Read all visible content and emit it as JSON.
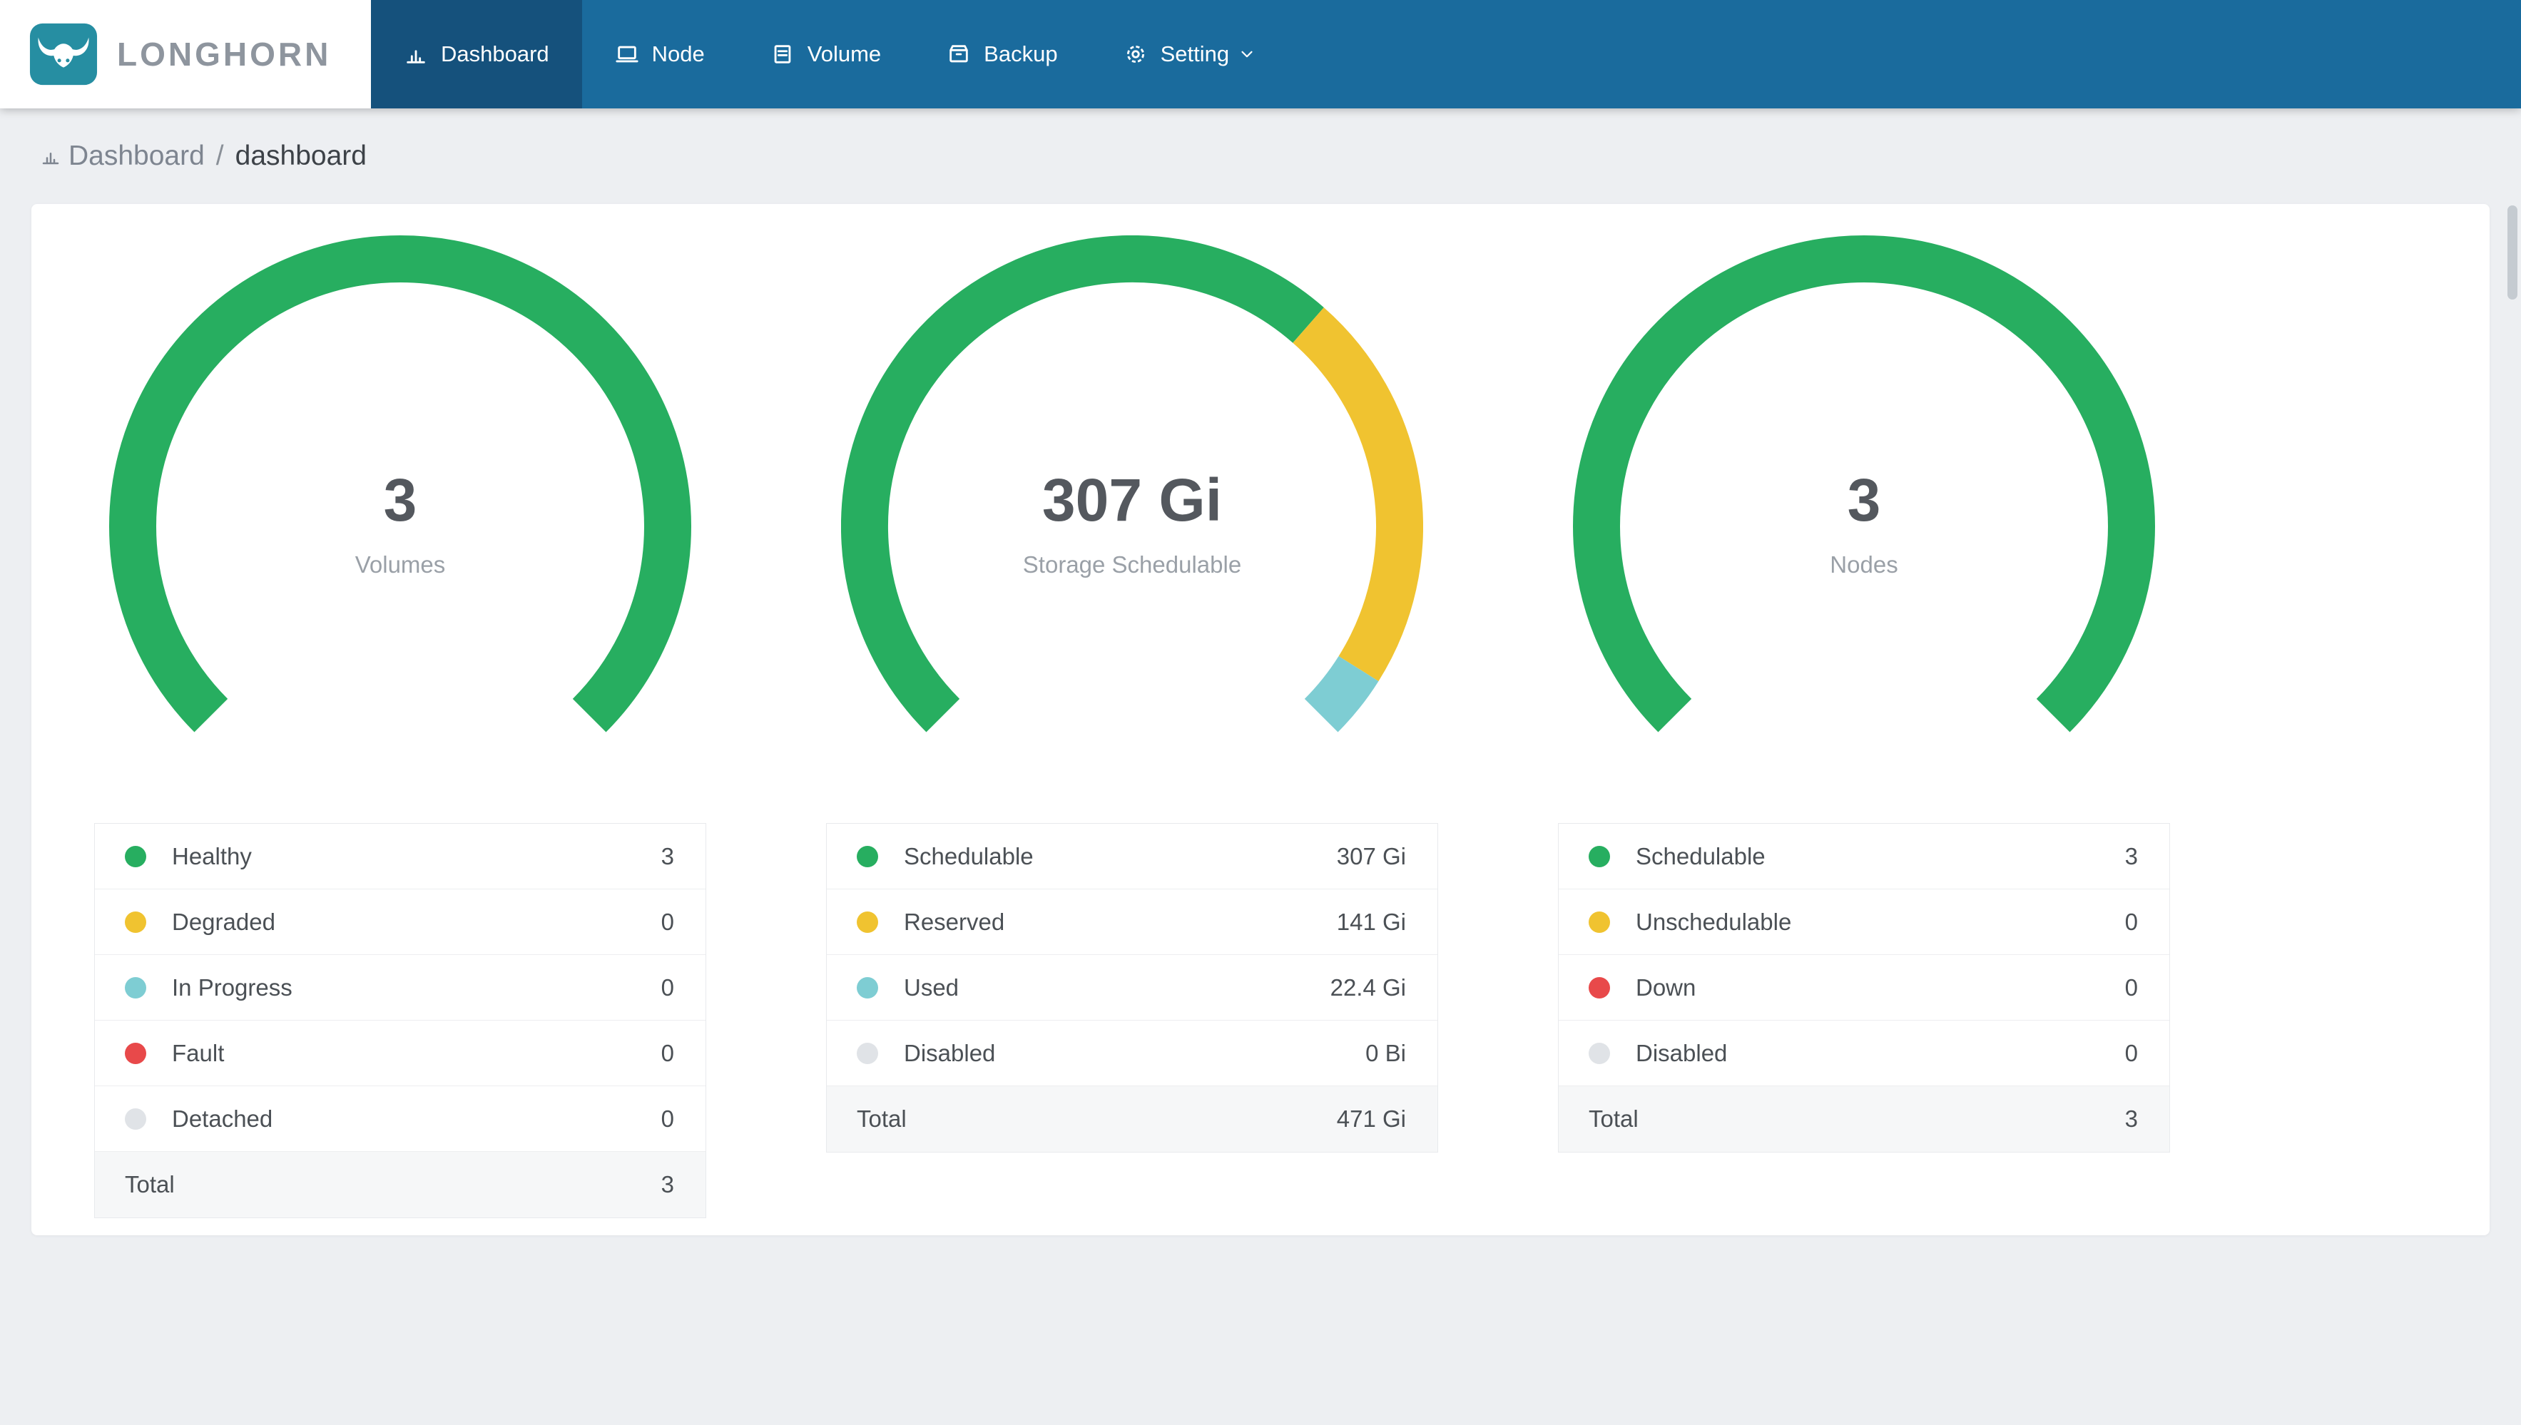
{
  "brand": {
    "name": "LONGHORN"
  },
  "nav": {
    "items": [
      {
        "label": "Dashboard",
        "active": true
      },
      {
        "label": "Node",
        "active": false
      },
      {
        "label": "Volume",
        "active": false
      },
      {
        "label": "Backup",
        "active": false
      },
      {
        "label": "Setting",
        "active": false,
        "dropdown": true
      }
    ]
  },
  "breadcrumb": {
    "root": "Dashboard",
    "separator": "/",
    "current": "dashboard"
  },
  "colors": {
    "green": "#27ae60",
    "yellow": "#f0c330",
    "teal": "#7ecdd3",
    "red": "#e8494a",
    "gray": "#e0e3e7",
    "nav_bg": "#1a6b9d",
    "nav_active_bg": "#15517c",
    "logo_teal": "#268ea2"
  },
  "chart_data": [
    {
      "type": "gauge",
      "center_value": "3",
      "center_label": "Volumes",
      "arc_degrees": 270,
      "gap_position": "bottom",
      "segments": [
        {
          "name": "Healthy",
          "value": 3,
          "color_key": "green"
        },
        {
          "name": "Degraded",
          "value": 0,
          "color_key": "yellow"
        },
        {
          "name": "In Progress",
          "value": 0,
          "color_key": "teal"
        },
        {
          "name": "Fault",
          "value": 0,
          "color_key": "red"
        },
        {
          "name": "Detached",
          "value": 0,
          "color_key": "gray"
        }
      ],
      "legend": [
        {
          "label": "Healthy",
          "value": "3",
          "color_key": "green"
        },
        {
          "label": "Degraded",
          "value": "0",
          "color_key": "yellow"
        },
        {
          "label": "In Progress",
          "value": "0",
          "color_key": "teal"
        },
        {
          "label": "Fault",
          "value": "0",
          "color_key": "red"
        },
        {
          "label": "Detached",
          "value": "0",
          "color_key": "gray"
        }
      ],
      "total": {
        "label": "Total",
        "value": "3"
      }
    },
    {
      "type": "gauge",
      "center_value": "307 Gi",
      "center_label": "Storage Schedulable",
      "arc_degrees": 270,
      "gap_position": "bottom",
      "segments": [
        {
          "name": "Schedulable",
          "value": 307,
          "color_key": "green"
        },
        {
          "name": "Reserved",
          "value": 141,
          "color_key": "yellow"
        },
        {
          "name": "Used",
          "value": 22.4,
          "color_key": "teal"
        },
        {
          "name": "Disabled",
          "value": 0,
          "color_key": "gray"
        }
      ],
      "legend": [
        {
          "label": "Schedulable",
          "value": "307 Gi",
          "color_key": "green"
        },
        {
          "label": "Reserved",
          "value": "141 Gi",
          "color_key": "yellow"
        },
        {
          "label": "Used",
          "value": "22.4 Gi",
          "color_key": "teal"
        },
        {
          "label": "Disabled",
          "value": "0 Bi",
          "color_key": "gray"
        }
      ],
      "total": {
        "label": "Total",
        "value": "471 Gi"
      }
    },
    {
      "type": "gauge",
      "center_value": "3",
      "center_label": "Nodes",
      "arc_degrees": 270,
      "gap_position": "bottom",
      "segments": [
        {
          "name": "Schedulable",
          "value": 3,
          "color_key": "green"
        },
        {
          "name": "Unschedulable",
          "value": 0,
          "color_key": "yellow"
        },
        {
          "name": "Down",
          "value": 0,
          "color_key": "red"
        },
        {
          "name": "Disabled",
          "value": 0,
          "color_key": "gray"
        }
      ],
      "legend": [
        {
          "label": "Schedulable",
          "value": "3",
          "color_key": "green"
        },
        {
          "label": "Unschedulable",
          "value": "0",
          "color_key": "yellow"
        },
        {
          "label": "Down",
          "value": "0",
          "color_key": "red"
        },
        {
          "label": "Disabled",
          "value": "0",
          "color_key": "gray"
        }
      ],
      "total": {
        "label": "Total",
        "value": "3"
      }
    }
  ]
}
